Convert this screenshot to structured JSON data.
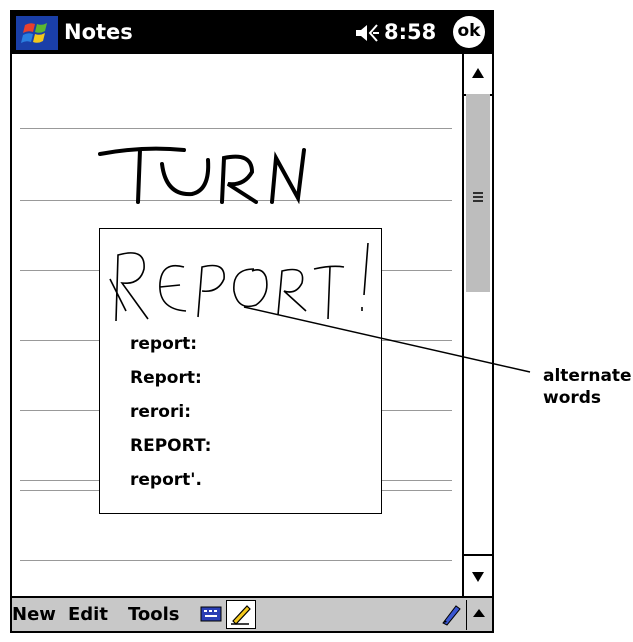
{
  "titlebar": {
    "app_title": "Notes",
    "time": "8:58",
    "ok_label": "ok"
  },
  "note": {
    "ink_header": "TURN",
    "popup": {
      "ink_word": "REPORT!",
      "alternates": [
        "report:",
        "Report:",
        "rerori:",
        "REPORT:",
        "report'."
      ]
    }
  },
  "menubar": {
    "items": [
      "New",
      "Edit",
      "Tools"
    ]
  },
  "callout": {
    "line1": "alternate",
    "line2": "words"
  },
  "icons": [
    "windows-start-icon",
    "speaker-icon",
    "scroll-up-icon",
    "scroll-down-icon",
    "scroll-grip-icon",
    "keyboard-icon",
    "pen-icon",
    "input-panel-arrow-icon"
  ]
}
